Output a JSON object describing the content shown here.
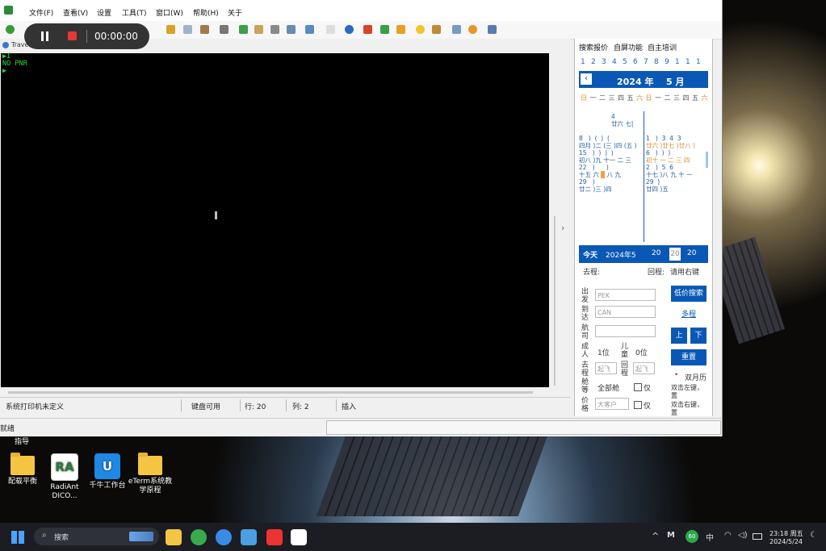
{
  "menu": [
    "文件(F)",
    "查看(V)",
    "设置",
    "工具(T)",
    "窗口(W)",
    "帮助(H)",
    "关于"
  ],
  "recorder": {
    "time": "00:00:00"
  },
  "tab": {
    "label": "Travelsky..."
  },
  "terminal": {
    "lines": [
      "▶I",
      "NO PNR",
      "▶"
    ]
  },
  "status": {
    "printer": "系统打印机未定义",
    "keyboard": "键盘可用",
    "row": "行: 20",
    "col": "列: 2",
    "mode": "插入"
  },
  "bottom_status": "就绪",
  "right_panel": {
    "tabs": [
      "搜索报价",
      "自屏功能",
      "自主培训"
    ],
    "numbers": [
      "1",
      "2",
      "3",
      "4",
      "5",
      "6",
      "7",
      "8",
      "9",
      "1",
      "1",
      "1"
    ],
    "year": "2024 年",
    "month": "5 月",
    "weekdays": [
      "日",
      "一",
      "二",
      "三",
      "四",
      "五",
      "六",
      "日",
      "一",
      "二",
      "三",
      "四",
      "五",
      "六"
    ],
    "today_label": "今天",
    "today_date": "2024年5",
    "today_vals": [
      "20",
      "20",
      "20"
    ],
    "depart_label": "去程:",
    "return_label": "回程:",
    "return_hint": "请用右键",
    "from_label": "出发",
    "to_label": "到达",
    "airline_label": "航司",
    "from_value": "PEK",
    "to_value": "CAN",
    "adult_label": "成人",
    "adult_count": "1位",
    "child_label": "儿童",
    "child_count": "0位",
    "time_label": "去程",
    "time_placeholder": "起飞",
    "return_time_label": "回程",
    "cabin_label": "舱等",
    "cabin_value": "全部舱",
    "price_label": "价格",
    "airport_placeholder": "大客户",
    "only_label": "仅",
    "search_button": "低价搜索",
    "multi_button": "多程",
    "up_button": "上",
    "down_button": "下",
    "reset_button": "重置",
    "dual_calendar": "双月历",
    "hint1": "双击左键，置",
    "hint2": "双击右键，置"
  },
  "desktop": {
    "top_label": "指导",
    "icons": [
      "配载平衡",
      "RadiAnt DICO...",
      "千牛工作台",
      "eTerm系统教学原程"
    ]
  },
  "taskbar": {
    "search": "搜索",
    "ime": "中",
    "badge": "60",
    "time": "23:18 周五",
    "date": "2024/5/24"
  }
}
